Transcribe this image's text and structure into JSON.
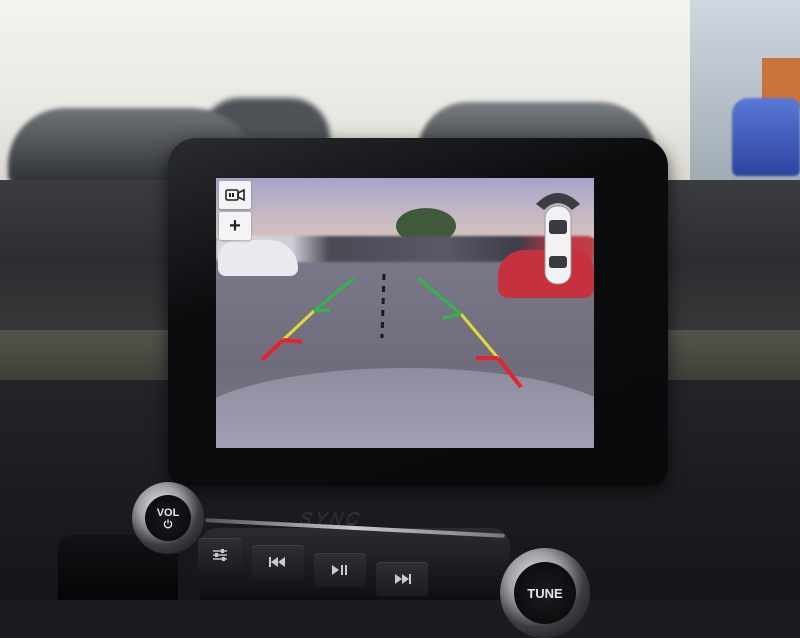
{
  "screen": {
    "top_buttons": [
      {
        "name": "camera-view",
        "icon": "camera-view-icon",
        "label": ""
      },
      {
        "name": "zoom",
        "icon": "plus-icon",
        "label": "+"
      }
    ],
    "guidelines": {
      "colors": {
        "far": "#2fb84a",
        "mid": "#e5d83a",
        "near": "#e2242d"
      },
      "center_line_color": "#1a1a1a"
    },
    "sensor_indicator": {
      "icon": "parking-sensor-car-icon",
      "zone_color": "#3b3d40",
      "car_color": "#f2f2f4"
    }
  },
  "controls": {
    "brand": "SYNC",
    "volume_knob": {
      "top": "VOL",
      "icon": "power-icon"
    },
    "tune_knob": {
      "label": "TUNE"
    },
    "buttons": [
      {
        "name": "settings",
        "icon": "sliders-icon"
      },
      {
        "name": "previous",
        "icon": "skip-back-icon"
      },
      {
        "name": "play-pause",
        "icon": "play-pause-icon"
      },
      {
        "name": "next",
        "icon": "skip-forward-icon"
      }
    ]
  }
}
